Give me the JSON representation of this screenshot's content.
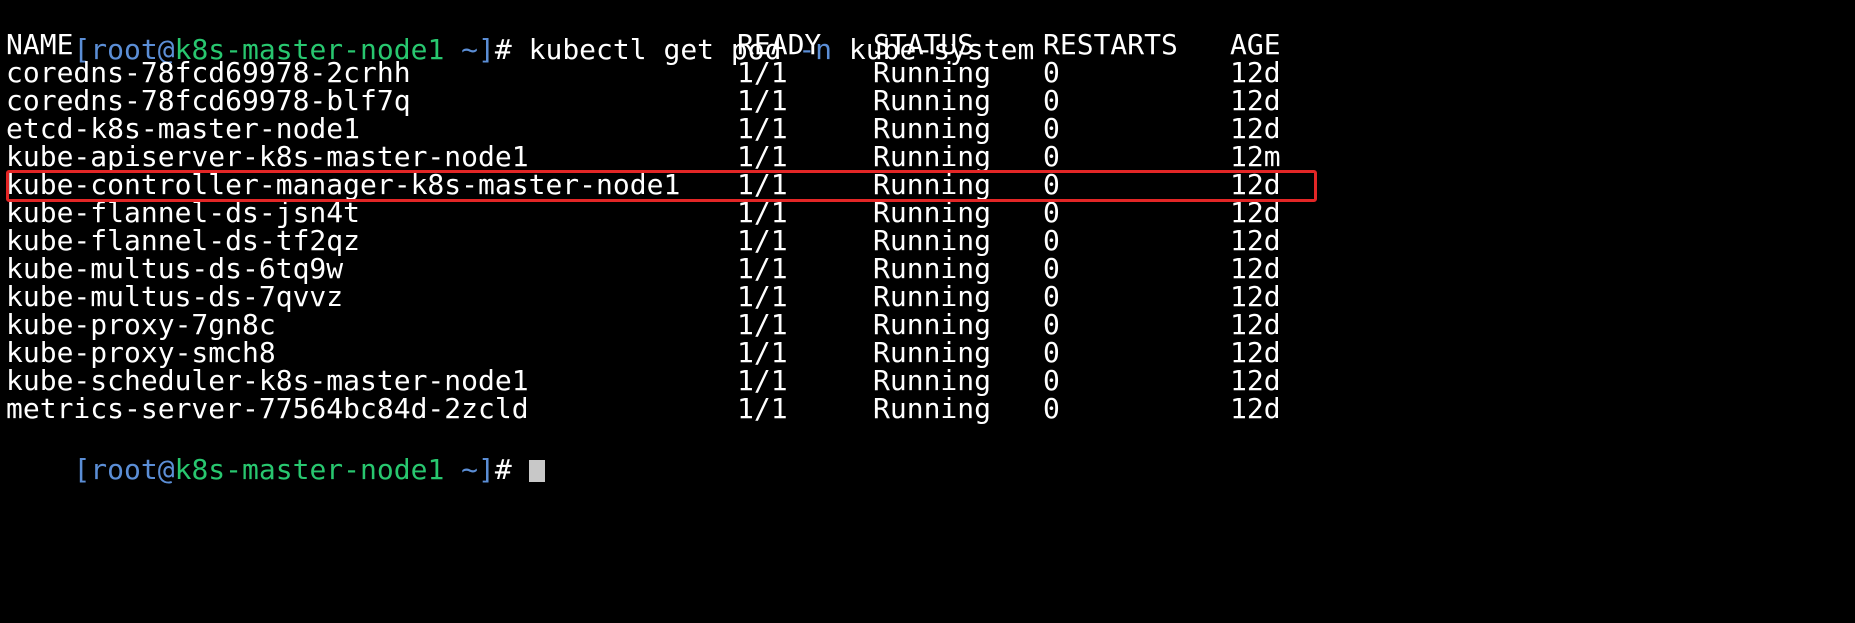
{
  "prompt": {
    "open_bracket": "[",
    "user": "root",
    "at": "@",
    "host": "k8s-master-node1",
    "dir": " ~",
    "close_bracket": "]",
    "sign": "# ",
    "command_main": "kubectl get pod ",
    "command_flag": "-n",
    "command_arg": " kube-system"
  },
  "table": {
    "headers": [
      "NAME",
      "READY",
      "STATUS",
      "RESTARTS",
      "AGE"
    ],
    "rows": [
      [
        "coredns-78fcd69978-2crhh",
        "1/1",
        "Running",
        "0",
        "12d"
      ],
      [
        "coredns-78fcd69978-blf7q",
        "1/1",
        "Running",
        "0",
        "12d"
      ],
      [
        "etcd-k8s-master-node1",
        "1/1",
        "Running",
        "0",
        "12d"
      ],
      [
        "kube-apiserver-k8s-master-node1",
        "1/1",
        "Running",
        "0",
        "12m"
      ],
      [
        "kube-controller-manager-k8s-master-node1",
        "1/1",
        "Running",
        "0",
        "12d"
      ],
      [
        "kube-flannel-ds-jsn4t",
        "1/1",
        "Running",
        "0",
        "12d"
      ],
      [
        "kube-flannel-ds-tf2qz",
        "1/1",
        "Running",
        "0",
        "12d"
      ],
      [
        "kube-multus-ds-6tq9w",
        "1/1",
        "Running",
        "0",
        "12d"
      ],
      [
        "kube-multus-ds-7qvvz",
        "1/1",
        "Running",
        "0",
        "12d"
      ],
      [
        "kube-proxy-7gn8c",
        "1/1",
        "Running",
        "0",
        "12d"
      ],
      [
        "kube-proxy-smch8",
        "1/1",
        "Running",
        "0",
        "12d"
      ],
      [
        "kube-scheduler-k8s-master-node1",
        "1/1",
        "Running",
        "0",
        "12d"
      ],
      [
        "metrics-server-77564bc84d-2zcld",
        "1/1",
        "Running",
        "0",
        "12d"
      ]
    ],
    "highlighted_row": 3
  },
  "prompt2": {
    "open_bracket": "[",
    "user": "root",
    "at": "@",
    "host": "k8s-master-node1",
    "dir": " ~",
    "close_bracket": "]",
    "sign": "# "
  },
  "colors": {
    "background": "#000000",
    "text": "#ffffff",
    "prompt_blue": "#5b8ed6",
    "prompt_green": "#28c76f",
    "highlight_border": "#e32626"
  }
}
